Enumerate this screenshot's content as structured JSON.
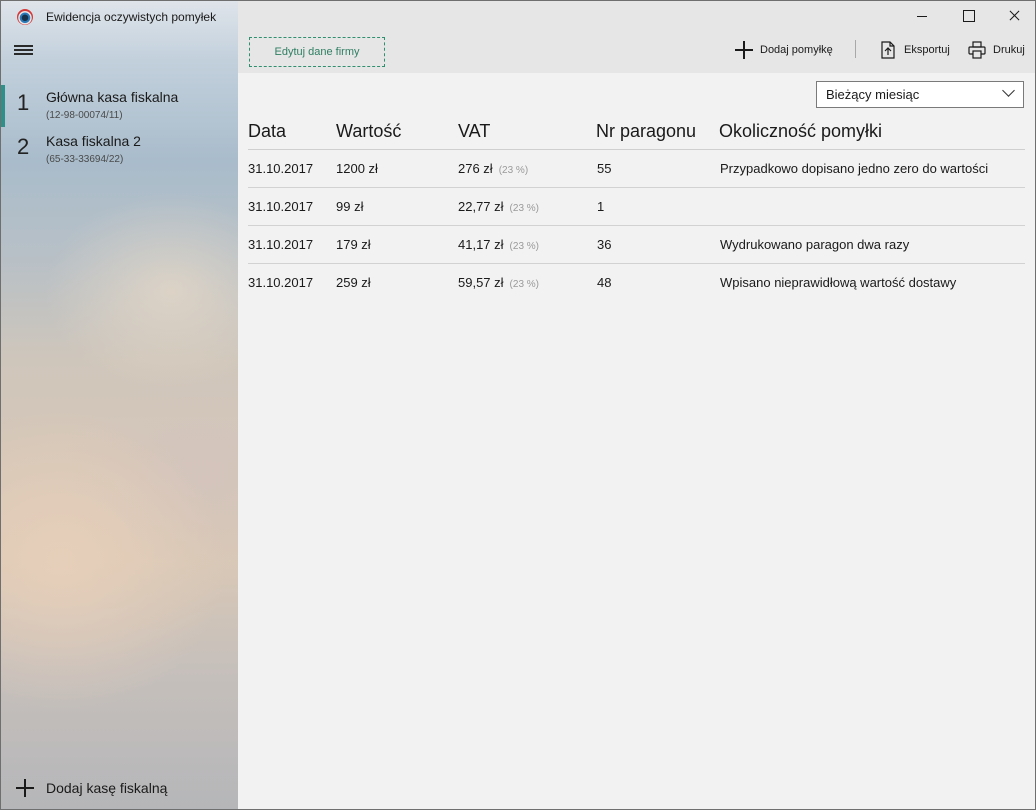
{
  "window": {
    "title": "Ewidencja oczywistych pomyłek"
  },
  "sidebar": {
    "registers": [
      {
        "number": "1",
        "name": "Główna kasa fiskalna",
        "id": "(12-98-00074/11)"
      },
      {
        "number": "2",
        "name": "Kasa fiskalna 2",
        "id": "(65-33-33694/22)"
      }
    ],
    "add_label": "Dodaj kasę fiskalną"
  },
  "toolbar": {
    "edit_company_label": "Edytuj dane firmy",
    "add_error_label": "Dodaj pomyłkę",
    "export_label": "Eksportuj",
    "print_label": "Drukuj"
  },
  "filter": {
    "selected": "Bieżący miesiąc"
  },
  "table": {
    "columns": [
      "Data",
      "Wartość",
      "VAT",
      "Nr paragonu",
      "Okoliczność pomyłki"
    ],
    "rows": [
      {
        "date": "31.10.2017",
        "value": "1200 zł",
        "vat": "276 zł",
        "vat_rate": "(23 %)",
        "receipt": "55",
        "reason": "Przypadkowo dopisano jedno zero do wartości"
      },
      {
        "date": "31.10.2017",
        "value": "99 zł",
        "vat": "22,77 zł",
        "vat_rate": "(23 %)",
        "receipt": "1",
        "reason": ""
      },
      {
        "date": "31.10.2017",
        "value": "179 zł",
        "vat": "41,17 zł",
        "vat_rate": "(23 %)",
        "receipt": "36",
        "reason": "Wydrukowano paragon dwa razy"
      },
      {
        "date": "31.10.2017",
        "value": "259 zł",
        "vat": "59,57 zł",
        "vat_rate": "(23 %)",
        "receipt": "48",
        "reason": "Wpisano nieprawidłową wartość dostawy"
      }
    ]
  },
  "colors": {
    "accent": "#2f8f89",
    "edit_button": "#2f7f63"
  }
}
